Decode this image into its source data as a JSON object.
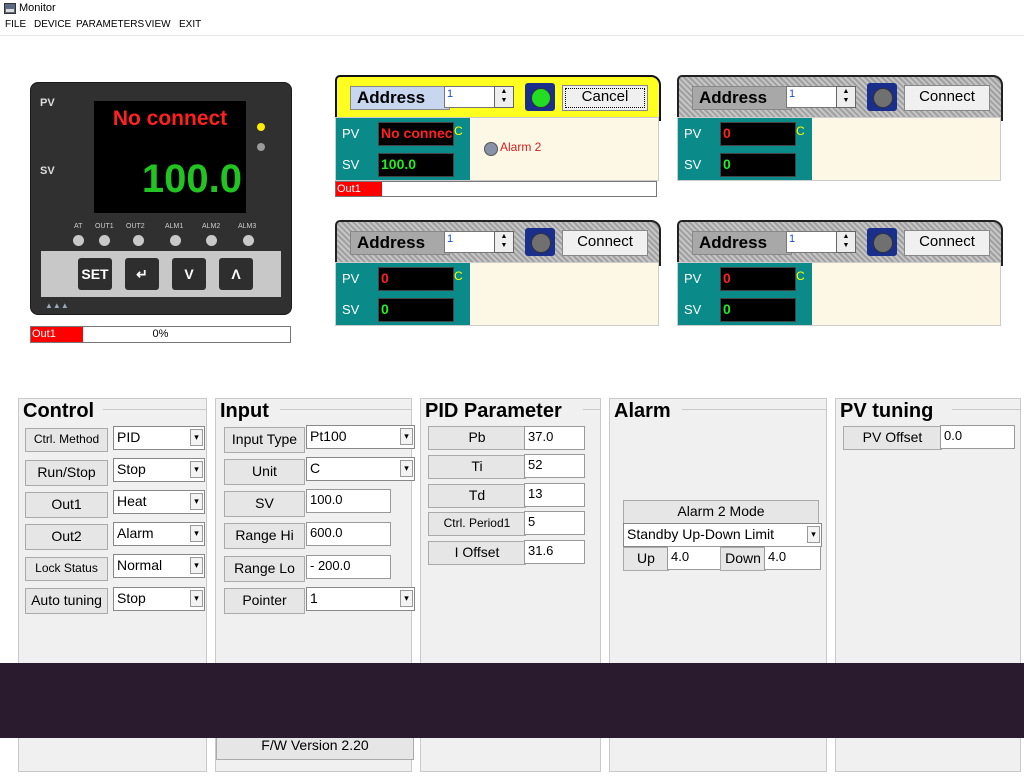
{
  "window": {
    "title": "Monitor"
  },
  "menu": [
    "FILE",
    "DEVICE",
    "PARAMETERS",
    "VIEW",
    "EXIT"
  ],
  "controller": {
    "pv_label": "PV",
    "sv_label": "SV",
    "pv_display": "No connect",
    "sv_display": "100.0",
    "leds": [
      "AT",
      "OUT1",
      "OUT2",
      "ALM1",
      "ALM2",
      "ALM3"
    ],
    "keys": [
      "SET",
      "↵",
      "V",
      "Λ"
    ],
    "output": {
      "label": "Out1",
      "percent_text": "0%",
      "fraction": 0.0
    }
  },
  "stations": [
    {
      "address_label": "Address",
      "address": "1",
      "button": "Cancel",
      "connected": true,
      "pv_label": "PV",
      "sv_label": "SV",
      "pv": "No connec",
      "pv_unit": "C",
      "sv": "100.0",
      "alarm": "Alarm 2",
      "out_label": "Out1",
      "out_fraction": 0.14
    },
    {
      "address_label": "Address",
      "address": "1",
      "button": "Connect",
      "connected": false,
      "pv_label": "PV",
      "sv_label": "SV",
      "pv": "0",
      "pv_unit": "C",
      "sv": "0"
    },
    {
      "address_label": "Address",
      "address": "1",
      "button": "Connect",
      "connected": false,
      "pv_label": "PV",
      "sv_label": "SV",
      "pv": "0",
      "pv_unit": "C",
      "sv": "0"
    },
    {
      "address_label": "Address",
      "address": "1",
      "button": "Connect",
      "connected": false,
      "pv_label": "PV",
      "sv_label": "SV",
      "pv": "0",
      "pv_unit": "C",
      "sv": "0"
    }
  ],
  "control": {
    "title": "Control",
    "rows": [
      {
        "label": "Ctrl. Method",
        "value": "PID"
      },
      {
        "label": "Run/Stop",
        "value": "Stop"
      },
      {
        "label": "Out1",
        "value": "Heat"
      },
      {
        "label": "Out2",
        "value": "Alarm"
      },
      {
        "label": "Lock Status",
        "value": "Normal"
      },
      {
        "label": "Auto tuning",
        "value": "Stop"
      }
    ]
  },
  "input": {
    "title": "Input",
    "input_type": {
      "label": "Input Type",
      "value": "Pt100"
    },
    "unit": {
      "label": "Unit",
      "value": "C"
    },
    "sv": {
      "label": "SV",
      "value": "100.0"
    },
    "range_hi": {
      "label": "Range Hi",
      "value": "600.0"
    },
    "range_lo": {
      "label": "Range Lo",
      "value": "- 200.0"
    },
    "pointer": {
      "label": "Pointer",
      "value": "1"
    },
    "fw_version": "F/W Version 2.20"
  },
  "pid": {
    "title": "PID Parameter",
    "rows": [
      {
        "label": "Pb",
        "value": "37.0"
      },
      {
        "label": "Ti",
        "value": "52"
      },
      {
        "label": "Td",
        "value": "13"
      },
      {
        "label": "Ctrl. Period1",
        "value": "5"
      },
      {
        "label": "I Offset",
        "value": "31.6"
      }
    ]
  },
  "alarm": {
    "title": "Alarm",
    "mode_button": "Alarm 2 Mode",
    "mode_value": "Standby Up-Down Limit",
    "up_label": "Up",
    "up_value": "4.0",
    "down_label": "Down",
    "down_value": "4.0"
  },
  "pv_tuning": {
    "title": "PV tuning",
    "offset_label": "PV Offset",
    "offset_value": "0.0"
  }
}
